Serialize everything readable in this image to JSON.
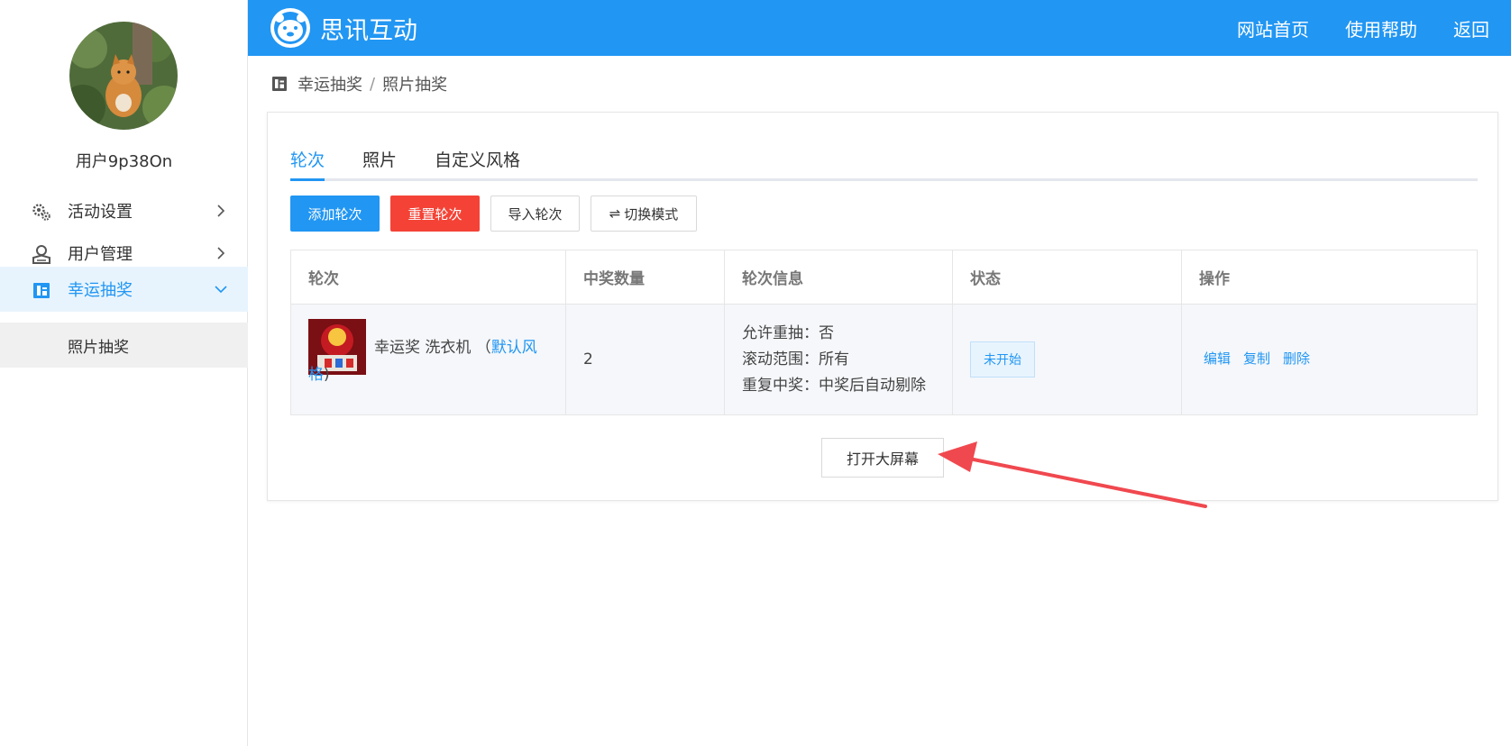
{
  "sidebar": {
    "username": "用户9p38On",
    "items": [
      {
        "label": "活动设置",
        "icon": "gears-icon"
      },
      {
        "label": "用户管理",
        "icon": "user-icon"
      },
      {
        "label": "幸运抽奖",
        "icon": "lottery-icon"
      }
    ],
    "subitem": "照片抽奖"
  },
  "topbar": {
    "brand": "思讯互动",
    "links": [
      "网站首页",
      "使用帮助",
      "返回"
    ]
  },
  "breadcrumb": {
    "parent": "幸运抽奖",
    "separator": "/",
    "current": "照片抽奖"
  },
  "tabs": [
    "轮次",
    "照片",
    "自定义风格"
  ],
  "buttons": {
    "add": "添加轮次",
    "reset": "重置轮次",
    "import": "导入轮次",
    "switch_icon": "⇌",
    "switch": "切换模式"
  },
  "table": {
    "headers": [
      "轮次",
      "中奖数量",
      "轮次信息",
      "状态",
      "操作"
    ],
    "row": {
      "prize_text": "幸运奖 洗衣机 （",
      "style_link": "默认风格",
      "prize_close": ")",
      "count": "2",
      "info": [
        "允许重抽：否",
        "滚动范围：所有",
        "重复中奖：中奖后自动剔除"
      ],
      "status": "未开始",
      "actions": [
        "编辑",
        "复制",
        "删除"
      ]
    }
  },
  "open_screen": "打开大屏幕",
  "colors": {
    "primary": "#2196f3",
    "danger": "#f44336",
    "annotation": "#f0484f"
  }
}
